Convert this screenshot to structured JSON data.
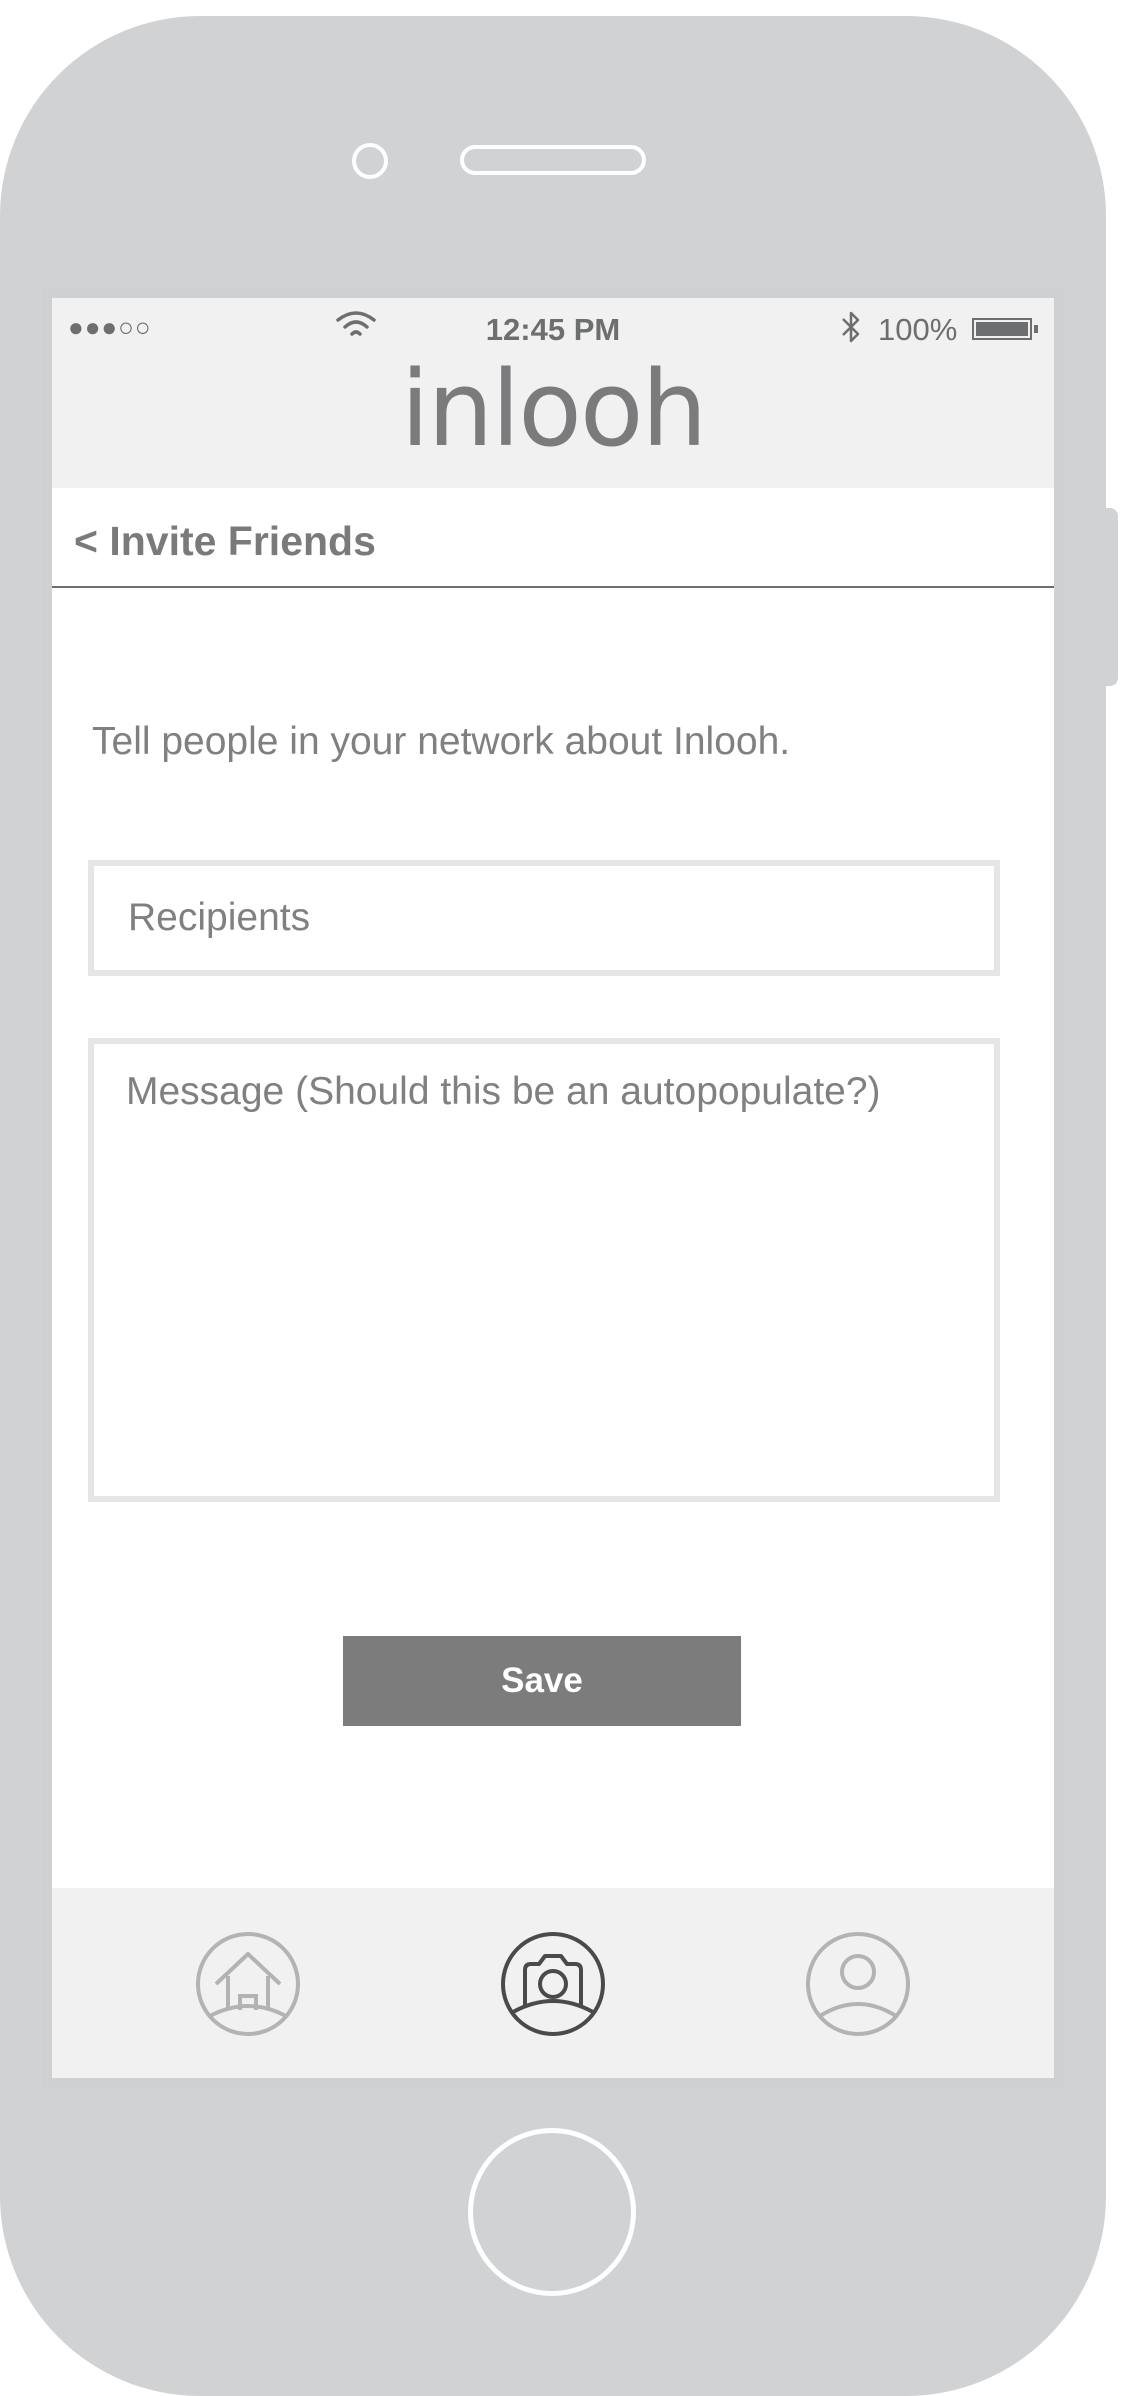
{
  "status_bar": {
    "signal": "●●●○○",
    "time": "12:45 PM",
    "battery": "100%"
  },
  "app": {
    "logo": "inlooh"
  },
  "nav": {
    "back_label": "< Invite Friends"
  },
  "content": {
    "intro": "Tell people in your network about Inlooh.",
    "recipients_placeholder": "Recipients",
    "message_placeholder": "Message (Should this be an autopopulate?)",
    "save_label": "Save"
  },
  "tab_bar": {
    "tabs": [
      {
        "icon": "home-icon",
        "active": false
      },
      {
        "icon": "camera-icon",
        "active": true
      },
      {
        "icon": "profile-icon",
        "active": false
      }
    ]
  },
  "colors": {
    "chassis": "#d1d2d4",
    "bar_background": "#f1f1f1",
    "text_gray": "#808082",
    "button": "#7c7c7c",
    "icon_inactive": "#b3b3b5",
    "icon_active": "#4a4a4c"
  }
}
